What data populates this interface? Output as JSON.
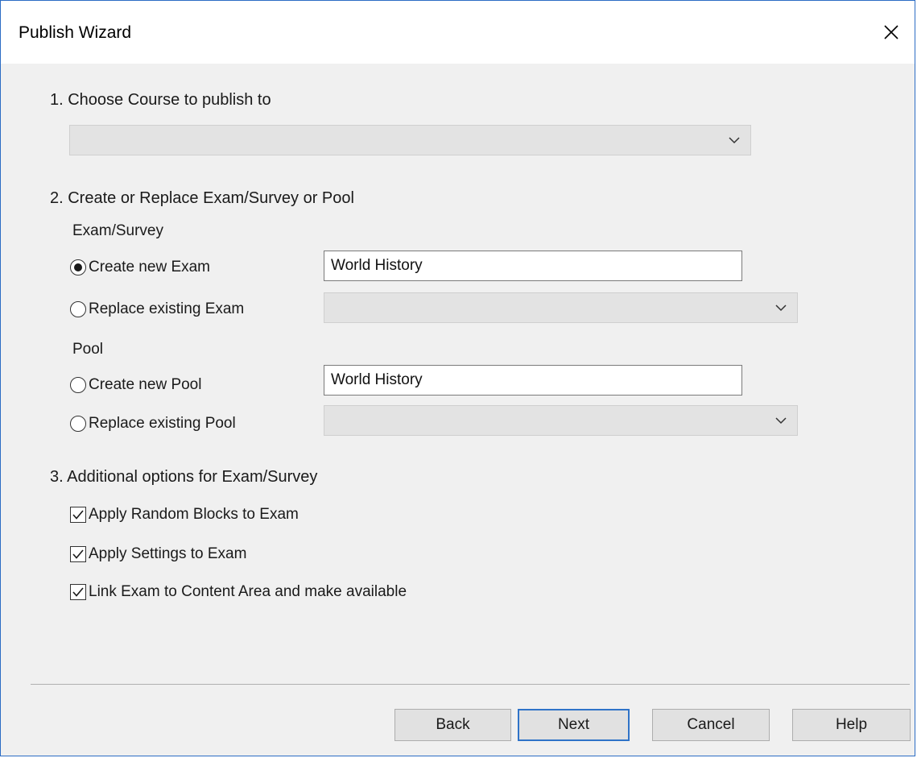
{
  "window": {
    "title": "Publish Wizard",
    "close_icon": "close-icon"
  },
  "step1": {
    "label": "1.  Choose Course to publish to",
    "course_value": ""
  },
  "step2": {
    "label": "2.  Create or Replace Exam/Survey or Pool",
    "exam_group_label": "Exam/Survey",
    "create_exam_label": "Create new Exam",
    "create_exam_selected": true,
    "create_exam_value": "World History",
    "replace_exam_label": "Replace existing Exam",
    "replace_exam_value": "",
    "pool_group_label": "Pool",
    "create_pool_label": "Create new Pool",
    "create_pool_value": "World History",
    "replace_pool_label": "Replace existing Pool",
    "replace_pool_value": ""
  },
  "step3": {
    "label": "3.  Additional options for Exam/Survey",
    "options": [
      {
        "label": "Apply Random Blocks to Exam",
        "checked": true
      },
      {
        "label": "Apply Settings to Exam",
        "checked": true
      },
      {
        "label": "Link Exam to Content Area and make available",
        "checked": true
      }
    ]
  },
  "buttons": {
    "back": "Back",
    "next": "Next",
    "cancel": "Cancel",
    "help": "Help"
  }
}
